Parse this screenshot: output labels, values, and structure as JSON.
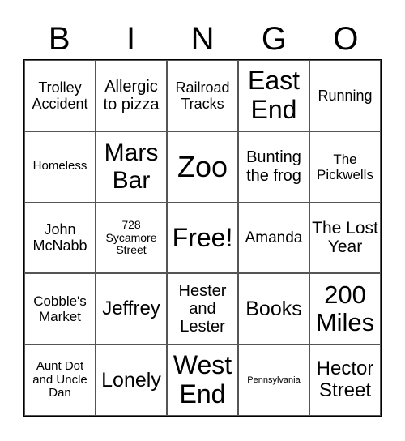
{
  "header": [
    "B",
    "I",
    "N",
    "G",
    "O"
  ],
  "cells": [
    "Trolley Accident",
    "Allergic to pizza",
    "Railroad Tracks",
    "East End",
    "Running",
    "Homeless",
    "Mars Bar",
    "Zoo",
    "Bunting the frog",
    "The Pickwells",
    "John McNabb",
    "728 Sycamore Street",
    "Free!",
    "Amanda",
    "The Lost Year",
    "Cobble's Market",
    "Jeffrey",
    "Hester and Lester",
    "Books",
    "200 Miles",
    "Aunt Dot and Uncle Dan",
    "Lonely",
    "West End",
    "Pennsylvania",
    "Hector Street"
  ]
}
